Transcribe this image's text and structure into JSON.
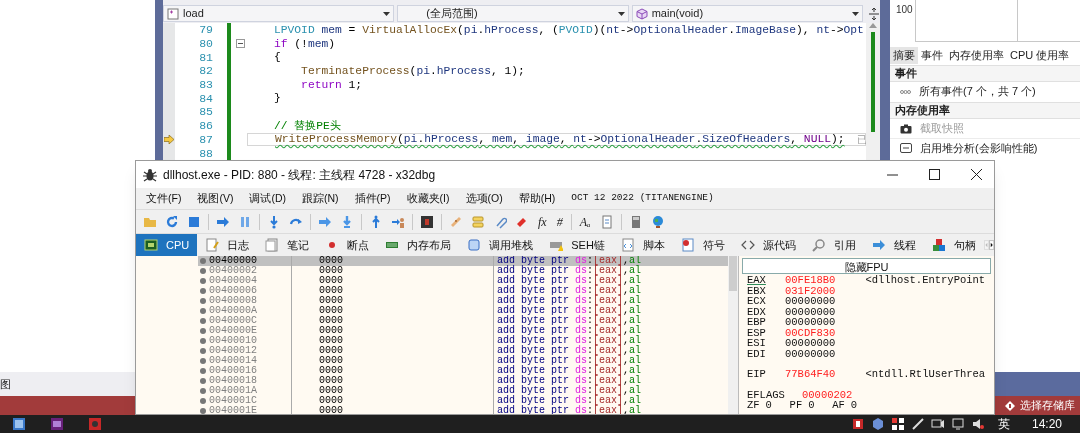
{
  "code_editor": {
    "nav_bar": [
      {
        "text": "load",
        "kind": "file"
      },
      {
        "text": "(全局范围)",
        "kind": "scope"
      },
      {
        "text": "main(void)",
        "kind": "member"
      }
    ],
    "lines": [
      {
        "number": "79",
        "current": false,
        "fold": false,
        "warning": false,
        "tokens": [
          {
            "text": "LPVOID",
            "kind": "type"
          },
          {
            "text": " mem",
            "kind": "id"
          },
          {
            "text": " = ",
            "kind": "p"
          },
          {
            "text": "VirtualAllocEx",
            "kind": "fn"
          },
          {
            "text": "(",
            "kind": "p"
          },
          {
            "text": "pi",
            "kind": "id"
          },
          {
            "text": ".",
            "kind": "p"
          },
          {
            "text": "hProcess",
            "kind": "id"
          },
          {
            "text": ", (",
            "kind": "p"
          },
          {
            "text": "PVOID",
            "kind": "type"
          },
          {
            "text": ")(",
            "kind": "p"
          },
          {
            "text": "nt",
            "kind": "id"
          },
          {
            "text": "->",
            "kind": "p"
          },
          {
            "text": "OptionalHeader",
            "kind": "id"
          },
          {
            "text": ".",
            "kind": "p"
          },
          {
            "text": "ImageBase",
            "kind": "id"
          },
          {
            "text": "), ",
            "kind": "p"
          },
          {
            "text": "nt",
            "kind": "id"
          },
          {
            "text": "->",
            "kind": "p"
          },
          {
            "text": "Opt",
            "kind": "id"
          }
        ]
      },
      {
        "number": "80",
        "current": false,
        "fold": true,
        "warning": false,
        "tokens": [
          {
            "text": "if",
            "kind": "kw"
          },
          {
            "text": " (!",
            "kind": "p"
          },
          {
            "text": "mem",
            "kind": "id"
          },
          {
            "text": ")",
            "kind": "p"
          }
        ]
      },
      {
        "number": "81",
        "current": false,
        "fold": false,
        "warning": false,
        "tokens": [
          {
            "text": "{",
            "kind": "p"
          }
        ]
      },
      {
        "number": "82",
        "current": false,
        "fold": false,
        "warning": false,
        "tokens": [
          {
            "text": "    TerminateProcess",
            "kind": "fn"
          },
          {
            "text": "(",
            "kind": "p"
          },
          {
            "text": "pi",
            "kind": "id"
          },
          {
            "text": ".",
            "kind": "p"
          },
          {
            "text": "hProcess",
            "kind": "id"
          },
          {
            "text": ", 1);",
            "kind": "p"
          }
        ]
      },
      {
        "number": "83",
        "current": false,
        "fold": false,
        "warning": false,
        "tokens": [
          {
            "text": "    return",
            "kind": "kw"
          },
          {
            "text": " 1;",
            "kind": "p"
          }
        ]
      },
      {
        "number": "84",
        "current": false,
        "fold": false,
        "warning": false,
        "tokens": [
          {
            "text": "}",
            "kind": "p"
          }
        ]
      },
      {
        "number": "85",
        "current": false,
        "fold": false
      },
      {
        "number": "86",
        "current": false,
        "fold": false,
        "warning": false,
        "tokens": [
          {
            "text": "// 替换PE头",
            "kind": "cm"
          }
        ]
      },
      {
        "number": "87",
        "current": true,
        "fold": false,
        "warning": true,
        "hint": "已",
        "tokens": [
          {
            "text": "WriteProcessMemory",
            "kind": "fn"
          },
          {
            "text": "(",
            "kind": "p"
          },
          {
            "text": "pi",
            "kind": "id"
          },
          {
            "text": ".",
            "kind": "p"
          },
          {
            "text": "hProcess",
            "kind": "id"
          },
          {
            "text": ", ",
            "kind": "p"
          },
          {
            "text": "mem",
            "kind": "id"
          },
          {
            "text": ", ",
            "kind": "p"
          },
          {
            "text": "image",
            "kind": "id"
          },
          {
            "text": ", ",
            "kind": "p"
          },
          {
            "text": "nt",
            "kind": "id"
          },
          {
            "text": "->",
            "kind": "p"
          },
          {
            "text": "OptionalHeader",
            "kind": "id"
          },
          {
            "text": ".",
            "kind": "p"
          },
          {
            "text": "SizeOfHeaders",
            "kind": "id"
          },
          {
            "text": ", ",
            "kind": "p"
          },
          {
            "text": "NULL",
            "kind": "mac"
          },
          {
            "text": ");",
            "kind": "p"
          }
        ]
      },
      {
        "number": "88",
        "current": false,
        "fold": false
      }
    ]
  },
  "diagnostics": {
    "axis_label": "100",
    "tabs": [
      {
        "label": "摘要",
        "selected": true
      },
      {
        "label": "事件",
        "selected": false
      },
      {
        "label": "内存使用率",
        "selected": false
      },
      {
        "label": "CPU 使用率",
        "selected": false
      }
    ],
    "sections": [
      {
        "title": "事件",
        "items": [
          {
            "text": "所有事件(7 个，共 7 个)",
            "kind": "events",
            "disabled": false
          }
        ]
      },
      {
        "title": "内存使用率",
        "items": [
          {
            "text": "截取快照",
            "kind": "camera",
            "disabled": true
          },
          {
            "text": "启用堆分析(会影响性能)",
            "kind": "heap",
            "disabled": false
          }
        ]
      }
    ]
  },
  "left_panel": {
    "text": "图"
  },
  "status_bar": {
    "text": "选择存储库"
  },
  "debugger": {
    "title": "dllhost.exe - PID: 880 - 线程: 主线程 4728 - x32dbg",
    "menu": [
      "文件(F)",
      "视图(V)",
      "调试(D)",
      "跟踪(N)",
      "插件(P)",
      "收藏夹(I)",
      "选项(O)",
      "帮助(H)"
    ],
    "build_info": "OCT 12 2022 (TITANENGINE)",
    "toolbar_glyphs": [
      "fx",
      "#",
      "Aₐ"
    ],
    "tabs": [
      {
        "label": "CPU",
        "selected": true
      },
      {
        "label": "日志",
        "selected": false
      },
      {
        "label": "笔记",
        "selected": false
      },
      {
        "label": "断点",
        "selected": false
      },
      {
        "label": "内存布局",
        "selected": false
      },
      {
        "label": "调用堆栈",
        "selected": false
      },
      {
        "label": "SEH链",
        "selected": false
      },
      {
        "label": "脚本",
        "selected": false
      },
      {
        "label": "符号",
        "selected": false
      },
      {
        "label": "源代码",
        "selected": false
      },
      {
        "label": "引用",
        "selected": false
      },
      {
        "label": "线程",
        "selected": false
      },
      {
        "label": "句柄",
        "selected": false
      }
    ],
    "disassembly": [
      {
        "address": "00400000",
        "bytes": "0000",
        "selected": true,
        "ins": [
          {
            "text": "add byte ptr ",
            "kind": "mn"
          },
          {
            "text": "ds",
            "kind": "seg"
          },
          {
            "text": ":",
            "kind": "p"
          },
          {
            "text": "[eax]",
            "kind": "mem"
          },
          {
            "text": ",",
            "kind": "p"
          },
          {
            "text": "al",
            "kind": "reg"
          }
        ]
      },
      {
        "address": "00400002",
        "bytes": "0000",
        "selected": false,
        "ins": [
          {
            "text": "add byte ptr ",
            "kind": "mn"
          },
          {
            "text": "ds",
            "kind": "seg"
          },
          {
            "text": ":",
            "kind": "p"
          },
          {
            "text": "[eax]",
            "kind": "mem"
          },
          {
            "text": ",",
            "kind": "p"
          },
          {
            "text": "al",
            "kind": "reg"
          }
        ]
      },
      {
        "address": "00400004",
        "bytes": "0000",
        "selected": false,
        "ins": [
          {
            "text": "add byte ptr ",
            "kind": "mn"
          },
          {
            "text": "ds",
            "kind": "seg"
          },
          {
            "text": ":",
            "kind": "p"
          },
          {
            "text": "[eax]",
            "kind": "mem"
          },
          {
            "text": ",",
            "kind": "p"
          },
          {
            "text": "al",
            "kind": "reg"
          }
        ]
      },
      {
        "address": "00400006",
        "bytes": "0000",
        "selected": false,
        "ins": [
          {
            "text": "add byte ptr ",
            "kind": "mn"
          },
          {
            "text": "ds",
            "kind": "seg"
          },
          {
            "text": ":",
            "kind": "p"
          },
          {
            "text": "[eax]",
            "kind": "mem"
          },
          {
            "text": ",",
            "kind": "p"
          },
          {
            "text": "al",
            "kind": "reg"
          }
        ]
      },
      {
        "address": "00400008",
        "bytes": "0000",
        "selected": false,
        "ins": [
          {
            "text": "add byte ptr ",
            "kind": "mn"
          },
          {
            "text": "ds",
            "kind": "seg"
          },
          {
            "text": ":",
            "kind": "p"
          },
          {
            "text": "[eax]",
            "kind": "mem"
          },
          {
            "text": ",",
            "kind": "p"
          },
          {
            "text": "al",
            "kind": "reg"
          }
        ]
      },
      {
        "address": "0040000A",
        "bytes": "0000",
        "selected": false,
        "ins": [
          {
            "text": "add byte ptr ",
            "kind": "mn"
          },
          {
            "text": "ds",
            "kind": "seg"
          },
          {
            "text": ":",
            "kind": "p"
          },
          {
            "text": "[eax]",
            "kind": "mem"
          },
          {
            "text": ",",
            "kind": "p"
          },
          {
            "text": "al",
            "kind": "reg"
          }
        ]
      },
      {
        "address": "0040000C",
        "bytes": "0000",
        "selected": false,
        "ins": [
          {
            "text": "add byte ptr ",
            "kind": "mn"
          },
          {
            "text": "ds",
            "kind": "seg"
          },
          {
            "text": ":",
            "kind": "p"
          },
          {
            "text": "[eax]",
            "kind": "mem"
          },
          {
            "text": ",",
            "kind": "p"
          },
          {
            "text": "al",
            "kind": "reg"
          }
        ]
      },
      {
        "address": "0040000E",
        "bytes": "0000",
        "selected": false,
        "ins": [
          {
            "text": "add byte ptr ",
            "kind": "mn"
          },
          {
            "text": "ds",
            "kind": "seg"
          },
          {
            "text": ":",
            "kind": "p"
          },
          {
            "text": "[eax]",
            "kind": "mem"
          },
          {
            "text": ",",
            "kind": "p"
          },
          {
            "text": "al",
            "kind": "reg"
          }
        ]
      },
      {
        "address": "00400010",
        "bytes": "0000",
        "selected": false,
        "ins": [
          {
            "text": "add byte ptr ",
            "kind": "mn"
          },
          {
            "text": "ds",
            "kind": "seg"
          },
          {
            "text": ":",
            "kind": "p"
          },
          {
            "text": "[eax]",
            "kind": "mem"
          },
          {
            "text": ",",
            "kind": "p"
          },
          {
            "text": "al",
            "kind": "reg"
          }
        ]
      },
      {
        "address": "00400012",
        "bytes": "0000",
        "selected": false,
        "ins": [
          {
            "text": "add byte ptr ",
            "kind": "mn"
          },
          {
            "text": "ds",
            "kind": "seg"
          },
          {
            "text": ":",
            "kind": "p"
          },
          {
            "text": "[eax]",
            "kind": "mem"
          },
          {
            "text": ",",
            "kind": "p"
          },
          {
            "text": "al",
            "kind": "reg"
          }
        ]
      },
      {
        "address": "00400014",
        "bytes": "0000",
        "selected": false,
        "ins": [
          {
            "text": "add byte ptr ",
            "kind": "mn"
          },
          {
            "text": "ds",
            "kind": "seg"
          },
          {
            "text": ":",
            "kind": "p"
          },
          {
            "text": "[eax]",
            "kind": "mem"
          },
          {
            "text": ",",
            "kind": "p"
          },
          {
            "text": "al",
            "kind": "reg"
          }
        ]
      },
      {
        "address": "00400016",
        "bytes": "0000",
        "selected": false,
        "ins": [
          {
            "text": "add byte ptr ",
            "kind": "mn"
          },
          {
            "text": "ds",
            "kind": "seg"
          },
          {
            "text": ":",
            "kind": "p"
          },
          {
            "text": "[eax]",
            "kind": "mem"
          },
          {
            "text": ",",
            "kind": "p"
          },
          {
            "text": "al",
            "kind": "reg"
          }
        ]
      },
      {
        "address": "00400018",
        "bytes": "0000",
        "selected": false,
        "ins": [
          {
            "text": "add byte ptr ",
            "kind": "mn"
          },
          {
            "text": "ds",
            "kind": "seg"
          },
          {
            "text": ":",
            "kind": "p"
          },
          {
            "text": "[eax]",
            "kind": "mem"
          },
          {
            "text": ",",
            "kind": "p"
          },
          {
            "text": "al",
            "kind": "reg"
          }
        ]
      },
      {
        "address": "0040001A",
        "bytes": "0000",
        "selected": false,
        "ins": [
          {
            "text": "add byte ptr ",
            "kind": "mn"
          },
          {
            "text": "ds",
            "kind": "seg"
          },
          {
            "text": ":",
            "kind": "p"
          },
          {
            "text": "[eax]",
            "kind": "mem"
          },
          {
            "text": ",",
            "kind": "p"
          },
          {
            "text": "al",
            "kind": "reg"
          }
        ]
      },
      {
        "address": "0040001C",
        "bytes": "0000",
        "selected": false,
        "ins": [
          {
            "text": "add byte ptr ",
            "kind": "mn"
          },
          {
            "text": "ds",
            "kind": "seg"
          },
          {
            "text": ":",
            "kind": "p"
          },
          {
            "text": "[eax]",
            "kind": "mem"
          },
          {
            "text": ",",
            "kind": "p"
          },
          {
            "text": "al",
            "kind": "reg"
          }
        ]
      },
      {
        "address": "0040001E",
        "bytes": "0000",
        "selected": false,
        "ins": [
          {
            "text": "add byte ptr ",
            "kind": "mn"
          },
          {
            "text": "ds",
            "kind": "seg"
          },
          {
            "text": ":",
            "kind": "p"
          },
          {
            "text": "[eax]",
            "kind": "mem"
          },
          {
            "text": ",",
            "kind": "p"
          },
          {
            "text": "al",
            "kind": "reg"
          }
        ]
      }
    ],
    "registers": {
      "toggle": "隐藏FPU",
      "groups": [
        {
          "kind": "gpr",
          "items": [
            {
              "name": "EAX",
              "value": "00FE18B0",
              "changed": true,
              "selected": true,
              "comment": "<dllhost.EntryPoint"
            },
            {
              "name": "EBX",
              "value": "031F2000",
              "changed": true,
              "selected": false
            },
            {
              "name": "ECX",
              "value": "00000000",
              "changed": false,
              "selected": false
            },
            {
              "name": "EDX",
              "value": "00000000",
              "changed": false,
              "selected": false
            },
            {
              "name": "EBP",
              "value": "00000000",
              "changed": false,
              "selected": false
            },
            {
              "name": "ESP",
              "value": "00CDF830",
              "changed": true,
              "selected": false
            },
            {
              "name": "ESI",
              "value": "00000000",
              "changed": false,
              "selected": false
            },
            {
              "name": "EDI",
              "value": "00000000",
              "changed": false,
              "selected": false
            }
          ]
        },
        {
          "kind": "ip",
          "items": [
            {
              "name": "EIP",
              "value": "77B64F40",
              "changed": true,
              "selected": false,
              "comment": "<ntdll.RtlUserThrea"
            }
          ]
        },
        {
          "kind": "flags",
          "items": [
            {
              "name": "EFLAGS",
              "value": "00000202",
              "changed": true,
              "selected": false
            }
          ]
        }
      ],
      "flags": [
        {
          "name": "ZF",
          "value": "0"
        },
        {
          "name": "PF",
          "value": "0"
        },
        {
          "name": "AF",
          "value": "0"
        }
      ]
    }
  },
  "taskbar": {
    "input_method": "英",
    "time": "14:20"
  }
}
